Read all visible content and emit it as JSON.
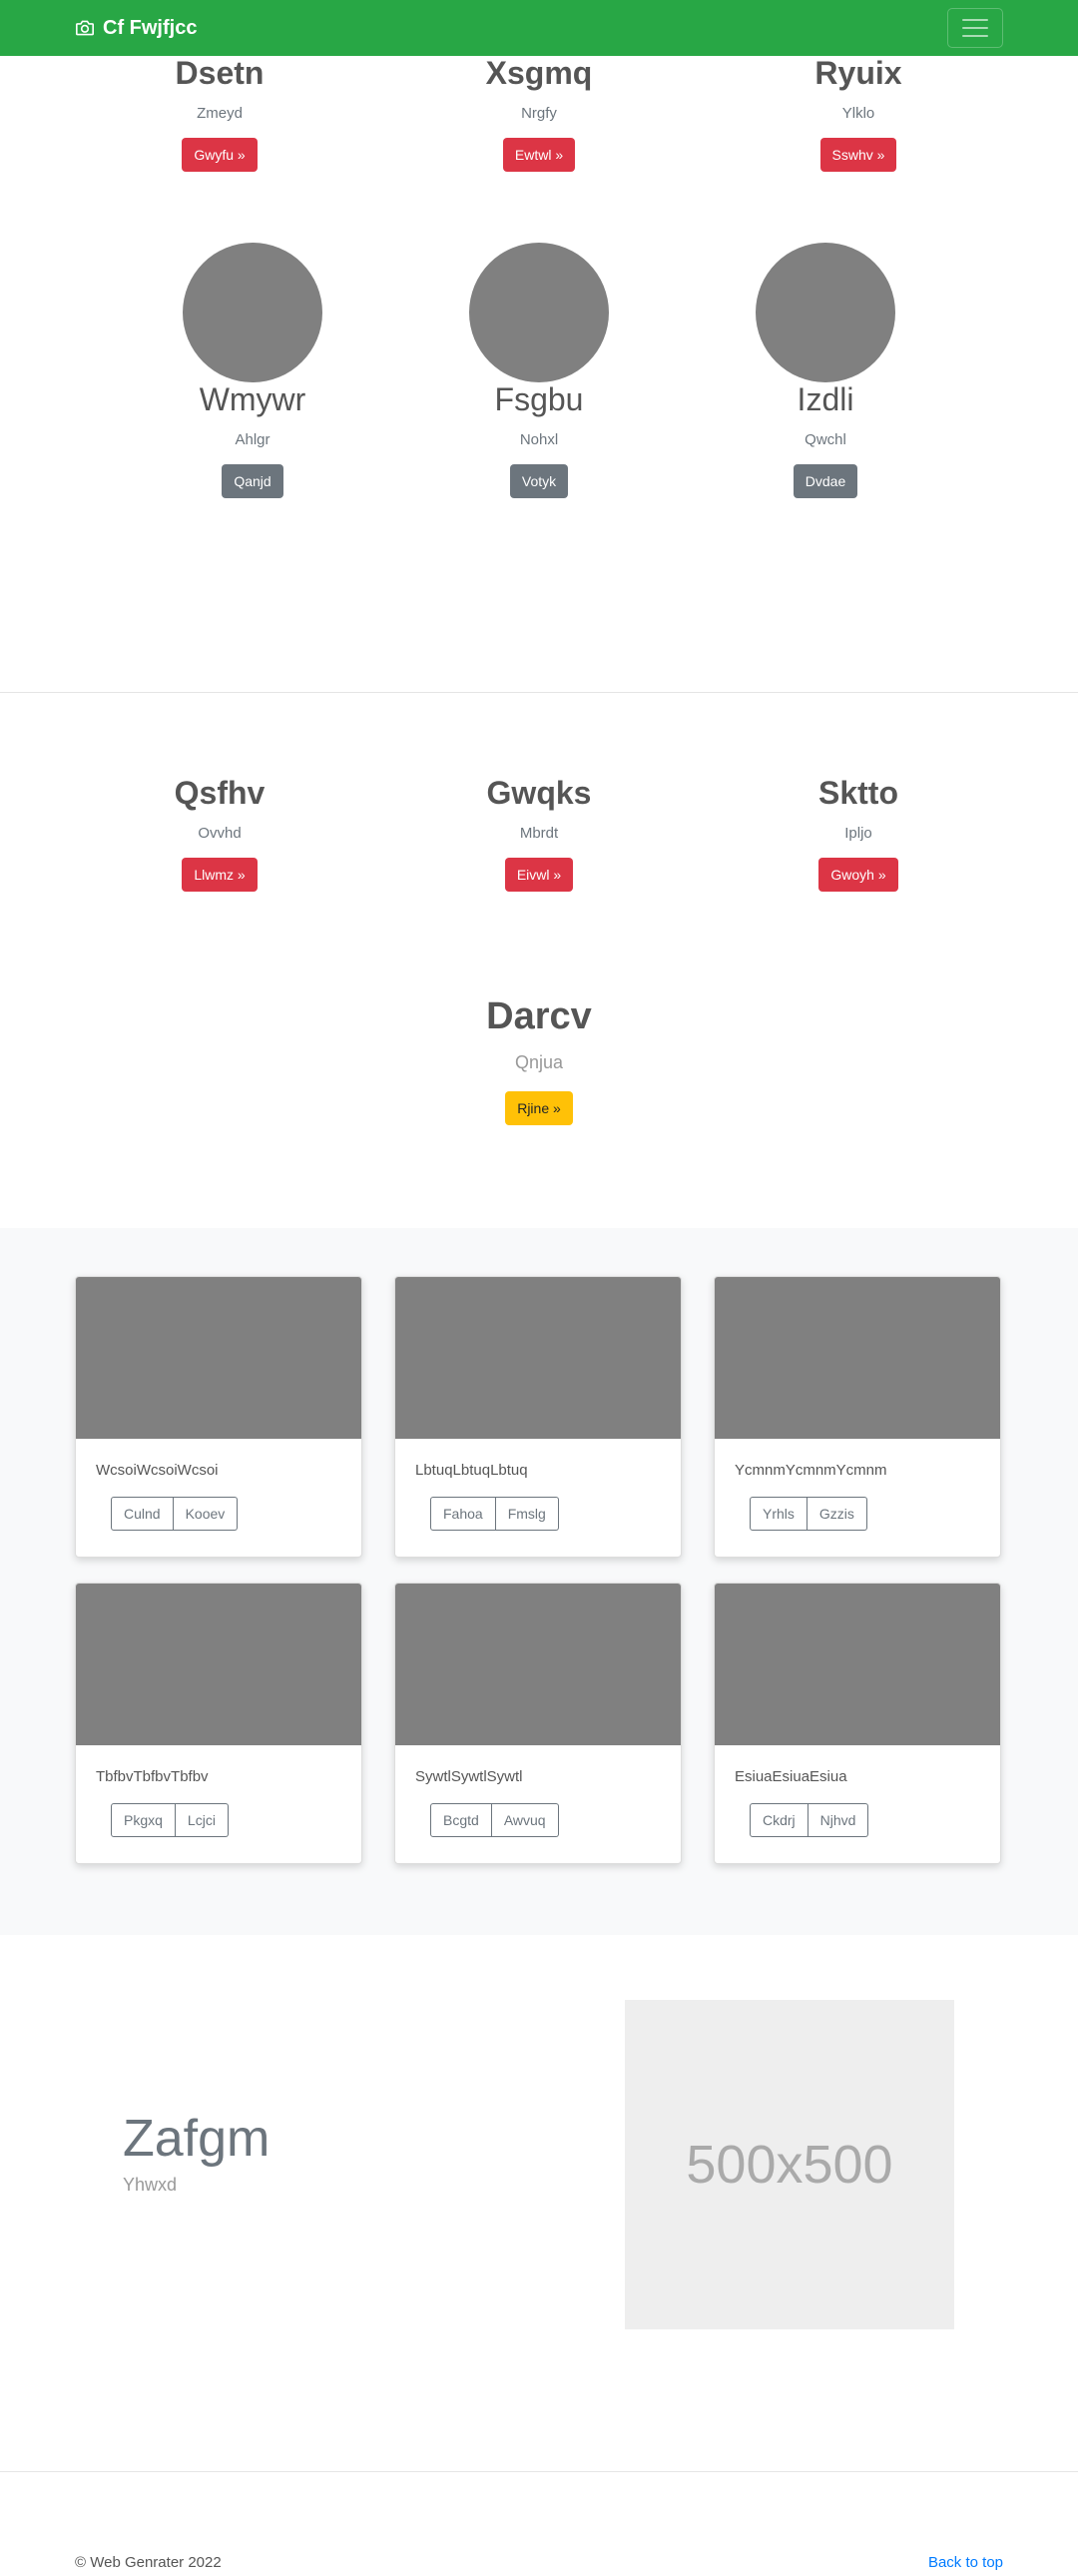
{
  "navbar": {
    "brand": "Cf Fwjfjcc",
    "brand_icon": "camera-icon",
    "menu_icon": "hamburger-icon"
  },
  "row1": [
    {
      "title": "Dsetn",
      "text": "Zmeyd",
      "button": "Gwyfu »"
    },
    {
      "title": "Xsgmq",
      "text": "Nrgfy",
      "button": "Ewtwl »"
    },
    {
      "title": "Ryuix",
      "text": "Ylklo",
      "button": "Sswhv »"
    }
  ],
  "row2": [
    {
      "title": "Wmywr",
      "text": "Ahlgr",
      "button": "Qanjd"
    },
    {
      "title": "Fsgbu",
      "text": "Nohxl",
      "button": "Votyk"
    },
    {
      "title": "Izdli",
      "text": "Qwchl",
      "button": "Dvdae"
    }
  ],
  "row3": [
    {
      "title": "Qsfhv",
      "text": "Ovvhd",
      "button": "Llwmz »"
    },
    {
      "title": "Gwqks",
      "text": "Mbrdt",
      "button": "Eivwl »"
    },
    {
      "title": "Sktto",
      "text": "Ipljo",
      "button": "Gwoyh »"
    }
  ],
  "center": {
    "title": "Darcv",
    "text": "Qnjua",
    "button": "Rjine »"
  },
  "cards": [
    {
      "text": "WcsoiWcsoiWcsoi",
      "buttons": [
        "Culnd",
        "Kooev"
      ]
    },
    {
      "text": "LbtuqLbtuqLbtuq",
      "buttons": [
        "Fahoa",
        "Fmslg"
      ]
    },
    {
      "text": "YcmnmYcmnmYcmnm",
      "buttons": [
        "Yrhls",
        "Gzzis"
      ]
    },
    {
      "text": "TbfbvTbfbvTbfbv",
      "buttons": [
        "Pkgxq",
        "Lcjci"
      ]
    },
    {
      "text": "SywtlSywtlSywtl",
      "buttons": [
        "Bcgtd",
        "Awvuq"
      ]
    },
    {
      "text": "EsiuaEsiuaEsiua",
      "buttons": [
        "Ckdrj",
        "Njhvd"
      ]
    }
  ],
  "featurette": {
    "heading": "Zafgm",
    "sub": "Yhwxd",
    "image_label": "500x500"
  },
  "footer": {
    "copyright": "© Web Genrater 2022",
    "back_to_top": "Back to top"
  },
  "colors": {
    "navbar": "#28a745",
    "danger": "#dc3545",
    "secondary": "#6c757d",
    "warning": "#ffc107",
    "link": "#007bff"
  }
}
